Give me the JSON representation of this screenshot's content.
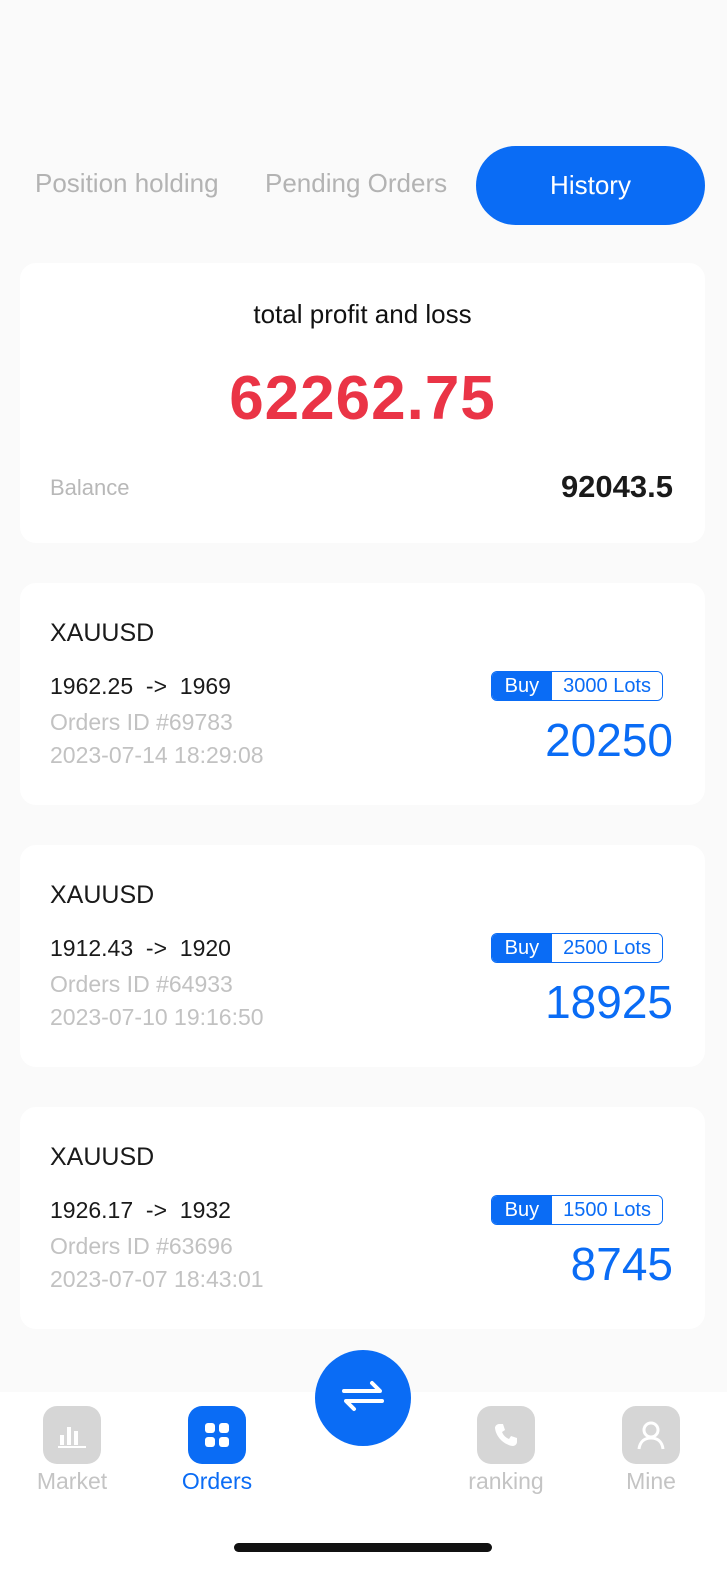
{
  "tabs": [
    {
      "label": "Position holding",
      "active": false
    },
    {
      "label": "Pending Orders",
      "active": false
    },
    {
      "label": "History",
      "active": true
    }
  ],
  "summary": {
    "title": "total profit and loss",
    "total": "62262.75",
    "balance_label": "Balance",
    "balance_value": "92043.5"
  },
  "orders": [
    {
      "symbol": "XAUUSD",
      "prices": "1962.25  ->  1969",
      "order_id": "Orders ID #69783",
      "time": "2023-07-14 18:29:08",
      "side": "Buy",
      "lots": "3000 Lots",
      "profit": "20250"
    },
    {
      "symbol": "XAUUSD",
      "prices": "1912.43  ->  1920",
      "order_id": "Orders ID #64933",
      "time": "2023-07-10 19:16:50",
      "side": "Buy",
      "lots": "2500 Lots",
      "profit": "18925"
    },
    {
      "symbol": "XAUUSD",
      "prices": "1926.17  ->  1932",
      "order_id": "Orders ID #63696",
      "time": "2023-07-07 18:43:01",
      "side": "Buy",
      "lots": "1500 Lots",
      "profit": "8745"
    }
  ],
  "nav": {
    "items": [
      {
        "label": "Market",
        "icon": "bar-chart-icon",
        "active": false
      },
      {
        "label": "Orders",
        "icon": "grid-icon",
        "active": true
      },
      {
        "label": "ranking",
        "icon": "phone-icon",
        "active": false
      },
      {
        "label": "Mine",
        "icon": "user-icon",
        "active": false
      }
    ],
    "center_icon": "swap-arrows-icon"
  },
  "colors": {
    "accent": "#0a6cf5",
    "loss_red": "#ea3446",
    "muted": "#c2c2c2"
  }
}
